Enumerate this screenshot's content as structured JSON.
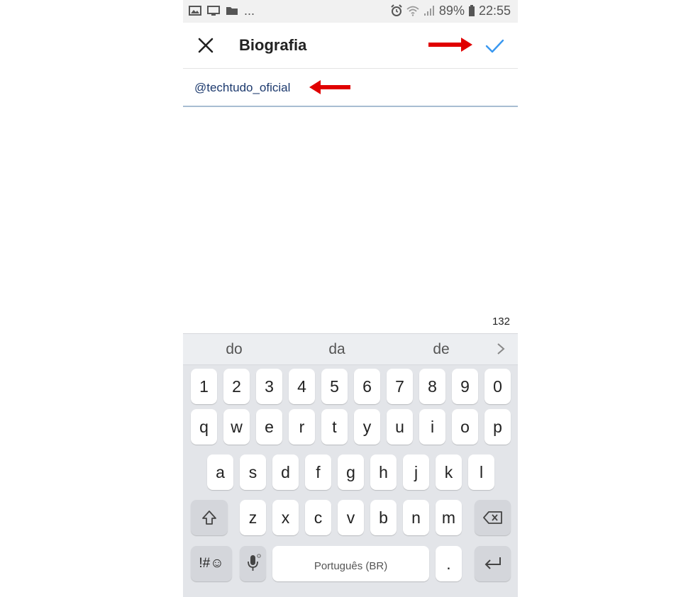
{
  "status_bar": {
    "left_icons": [
      "image-icon",
      "screen-icon",
      "folder-icon"
    ],
    "more": "...",
    "right_icons": [
      "alarm-icon",
      "wifi-icon",
      "signal-icon"
    ],
    "battery": "89%",
    "time": "22:55"
  },
  "header": {
    "title": "Biografia",
    "close_icon": "close-icon",
    "confirm_icon": "check-icon"
  },
  "bio": {
    "value": "@techtudo_oficial"
  },
  "char_counter": "132",
  "keyboard": {
    "suggestions": [
      "do",
      "da",
      "de"
    ],
    "row_numbers": [
      "1",
      "2",
      "3",
      "4",
      "5",
      "6",
      "7",
      "8",
      "9",
      "0"
    ],
    "row_1": [
      "q",
      "w",
      "e",
      "r",
      "t",
      "y",
      "u",
      "i",
      "o",
      "p"
    ],
    "row_2": [
      "a",
      "s",
      "d",
      "f",
      "g",
      "h",
      "j",
      "k",
      "l"
    ],
    "row_3": [
      "z",
      "x",
      "c",
      "v",
      "b",
      "n",
      "m"
    ],
    "symbols_key": "!#☺",
    "space_label": "Português (BR)",
    "period_key": "."
  },
  "colors": {
    "accent": "#3897f0",
    "annotation_arrow": "#e00000",
    "bio_text": "#1d3a6e",
    "keyboard_bg": "#e3e5e9"
  }
}
